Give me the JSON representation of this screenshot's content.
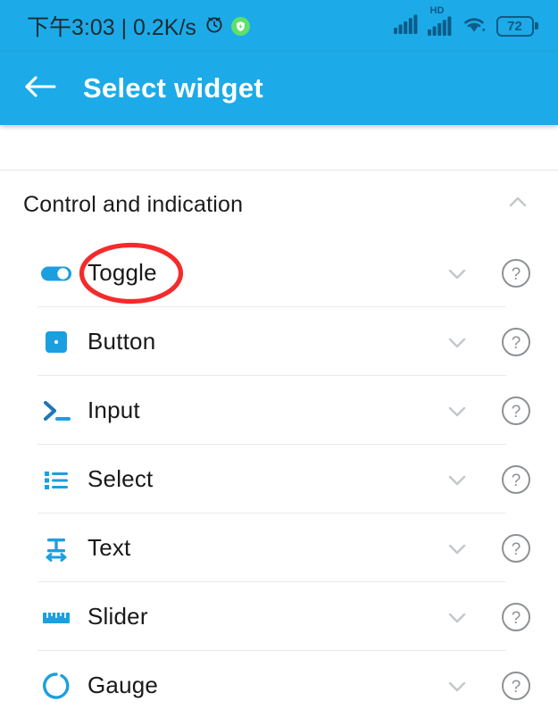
{
  "status_bar": {
    "time": "下午3:03 | 0.2K/s",
    "alarm_icon": "alarm-clock-icon",
    "shield_icon": "green-shield-icon",
    "signal_icon": "signal-bars-icon",
    "signal_hd_icon": "signal-bars-hd-icon",
    "hd_label": "HD",
    "wifi_icon": "wifi-icon",
    "battery_level": "72",
    "background_color": "#1cabe8"
  },
  "app_bar": {
    "back_icon": "back-arrow-icon",
    "title": "Select widget",
    "background_color": "#1cabe8",
    "title_color": "#ffffff"
  },
  "section": {
    "title": "Control and indication",
    "collapse_icon": "chevron-up-icon",
    "expanded": true
  },
  "widgets": [
    {
      "label": "Toggle",
      "icon": "toggle-switch-icon",
      "expand_icon": "chevron-down-icon",
      "help_icon": "help-circle-icon",
      "highlighted": true
    },
    {
      "label": "Button",
      "icon": "button-square-icon",
      "expand_icon": "chevron-down-icon",
      "help_icon": "help-circle-icon",
      "highlighted": false
    },
    {
      "label": "Input",
      "icon": "terminal-prompt-icon",
      "expand_icon": "chevron-down-icon",
      "help_icon": "help-circle-icon",
      "highlighted": false
    },
    {
      "label": "Select",
      "icon": "bulleted-list-icon",
      "expand_icon": "chevron-down-icon",
      "help_icon": "help-circle-icon",
      "highlighted": false
    },
    {
      "label": "Text",
      "icon": "text-resize-icon",
      "expand_icon": "chevron-down-icon",
      "help_icon": "help-circle-icon",
      "highlighted": false
    },
    {
      "label": "Slider",
      "icon": "ruler-slider-icon",
      "expand_icon": "chevron-down-icon",
      "help_icon": "help-circle-icon",
      "highlighted": false
    },
    {
      "label": "Gauge",
      "icon": "gauge-ring-icon",
      "expand_icon": "chevron-down-icon",
      "help_icon": "help-circle-icon",
      "highlighted": false
    }
  ],
  "annotation": {
    "shape": "ellipse",
    "color": "#f42b2b",
    "target_label": "Toggle"
  },
  "colors": {
    "accent_blue": "#1cabe8",
    "icon_blue": "#1c9fe0",
    "annotation_red": "#f42b2b",
    "divider": "#e8eaec",
    "text_primary": "#191919",
    "chevron_gray": "#c3c7ca",
    "help_gray": "#8d9194"
  }
}
